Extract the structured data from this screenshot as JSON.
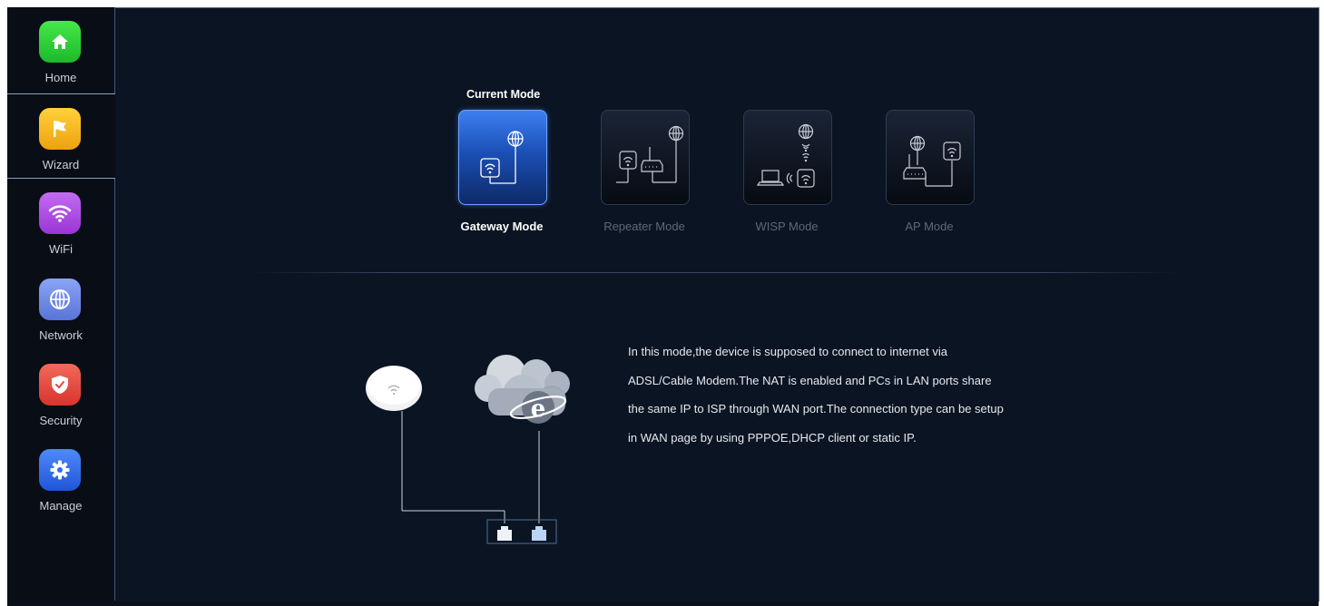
{
  "sidebar": {
    "items": [
      {
        "label": "Home",
        "icon": "home-icon",
        "color": "#2fd23a"
      },
      {
        "label": "Wizard",
        "icon": "flag-icon",
        "color": "#f2b41e",
        "active": true
      },
      {
        "label": "WiFi",
        "icon": "wifi-icon",
        "color": "#b44ee6"
      },
      {
        "label": "Network",
        "icon": "globe-icon",
        "color": "#6a86e8"
      },
      {
        "label": "Security",
        "icon": "shield-icon",
        "color": "#e4473f"
      },
      {
        "label": "Manage",
        "icon": "gear-icon",
        "color": "#2f6cf0"
      }
    ]
  },
  "main": {
    "current_mode_label": "Current Mode",
    "modes": [
      {
        "label": "Gateway Mode",
        "active": true
      },
      {
        "label": "Repeater Mode"
      },
      {
        "label": "WISP Mode"
      },
      {
        "label": "AP Mode"
      }
    ],
    "description": "In this mode,the device is supposed to connect to internet via ADSL/Cable Modem.The NAT is enabled and PCs in LAN ports share the same IP to ISP through WAN port.The connection type can be setup in WAN page by using PPPOE,DHCP client or static IP."
  },
  "colors": {
    "background": "#0b1422",
    "sidebar": "#090d15",
    "accent": "#2b6ff2"
  }
}
